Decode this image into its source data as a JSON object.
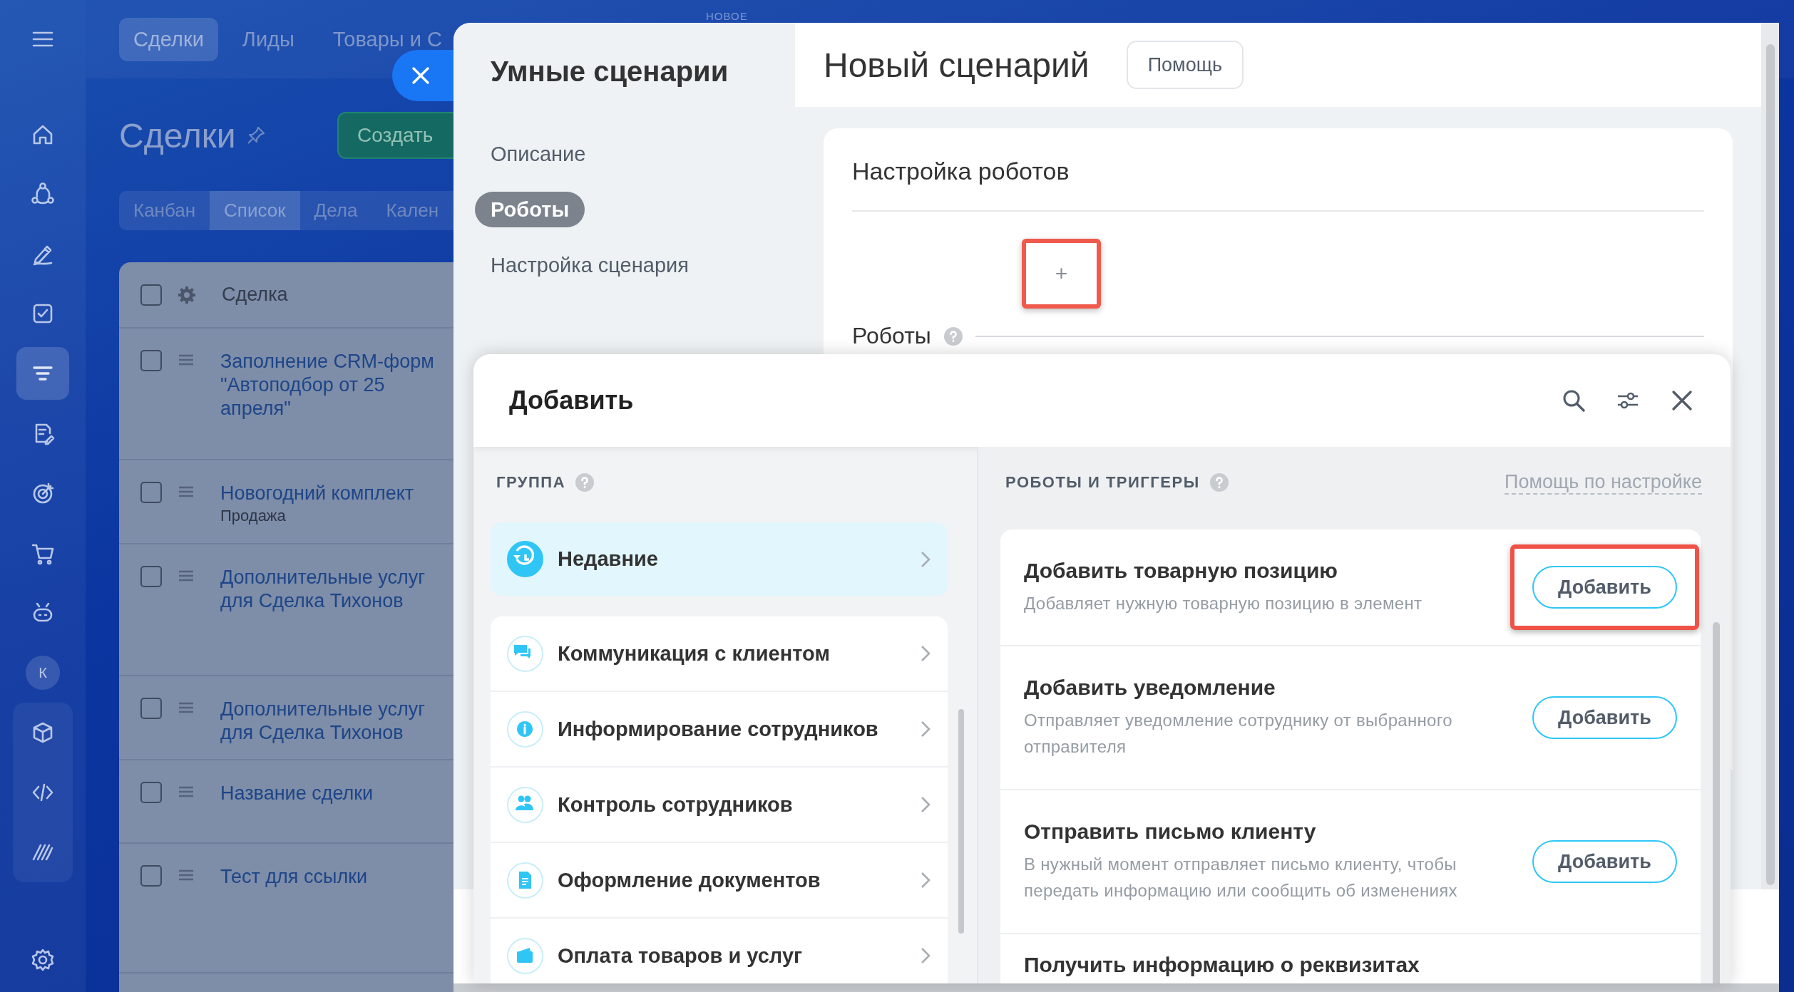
{
  "rail": {
    "items": [
      {
        "selected": false
      },
      {
        "selected": false
      },
      {
        "selected": false
      },
      {
        "selected": false
      },
      {
        "selected": true
      },
      {
        "selected": false
      },
      {
        "selected": false
      },
      {
        "selected": false
      },
      {
        "selected": false
      }
    ],
    "avatar": "К"
  },
  "crm": {
    "top_tabs": [
      {
        "label": "Сделки",
        "selected": true
      },
      {
        "label": "Лиды",
        "selected": false
      },
      {
        "label": "Товары и С",
        "selected": false
      }
    ],
    "title": "Сделки",
    "create_button": "Создать",
    "view_tabs": [
      {
        "label": "Канбан",
        "selected": false
      },
      {
        "label": "Список",
        "selected": true
      },
      {
        "label": "Дела",
        "selected": false
      },
      {
        "label": "Кален",
        "selected": false
      }
    ],
    "table": {
      "select_all_checked": false,
      "columns": [
        "Сделка"
      ],
      "rows": [
        {
          "title": "Заполнение CRM-форм\n\"Автоподбор от 25\nапреля\"",
          "checked": false
        },
        {
          "title": "Новогодний комплект",
          "subtitle": "Продажа",
          "checked": false
        },
        {
          "title": "Дополнительные услуг\nдля Сделка Тихонов",
          "checked": false
        },
        {
          "title": "Дополнительные услуг\nдля Сделка Тихонов",
          "checked": false
        },
        {
          "title": "Название сделки",
          "checked": false
        },
        {
          "title": "Тест для ссылки",
          "checked": false
        }
      ]
    }
  },
  "badge": "НОВОЕ",
  "slider": {
    "title": "Умные сценарии",
    "nav": [
      {
        "label": "Описание",
        "selected": false
      },
      {
        "label": "Роботы",
        "selected": true
      },
      {
        "label": "Настройка сценария",
        "selected": false
      }
    ],
    "heading": "Новый сценарий",
    "help_button": "Помощь",
    "card_title": "Настройка роботов",
    "add_button": {
      "label": "+",
      "highlighted": true
    },
    "robots_label": "Роботы"
  },
  "popup": {
    "title": "Добавить",
    "group_header": "ГРУППА",
    "groups": [
      {
        "label": "Недавние",
        "selected": true
      },
      {
        "label": "Коммуникация с клиентом",
        "selected": false
      },
      {
        "label": "Информирование сотрудников",
        "selected": false
      },
      {
        "label": "Контроль сотрудников",
        "selected": false
      },
      {
        "label": "Оформление документов",
        "selected": false
      },
      {
        "label": "Оплата товаров и услуг",
        "selected": false
      }
    ],
    "robots_header": "РОБОТЫ И ТРИГГЕРЫ",
    "help_link": "Помощь по настройке",
    "robots": [
      {
        "title": "Добавить товарную позицию",
        "description": "Добавляет нужную товарную позицию в элемент",
        "button": "Добавить",
        "highlighted": true
      },
      {
        "title": "Добавить уведомление",
        "description": "Отправляет уведомление сотруднику от выбранного отправителя",
        "button": "Добавить",
        "highlighted": false
      },
      {
        "title": "Отправить письмо клиенту",
        "description": "В нужный момент отправляет письмо клиенту, чтобы передать информацию или сообщить об изменениях",
        "button": "Добавить",
        "highlighted": false
      },
      {
        "title": "Получить информацию о реквизитах"
      }
    ]
  }
}
